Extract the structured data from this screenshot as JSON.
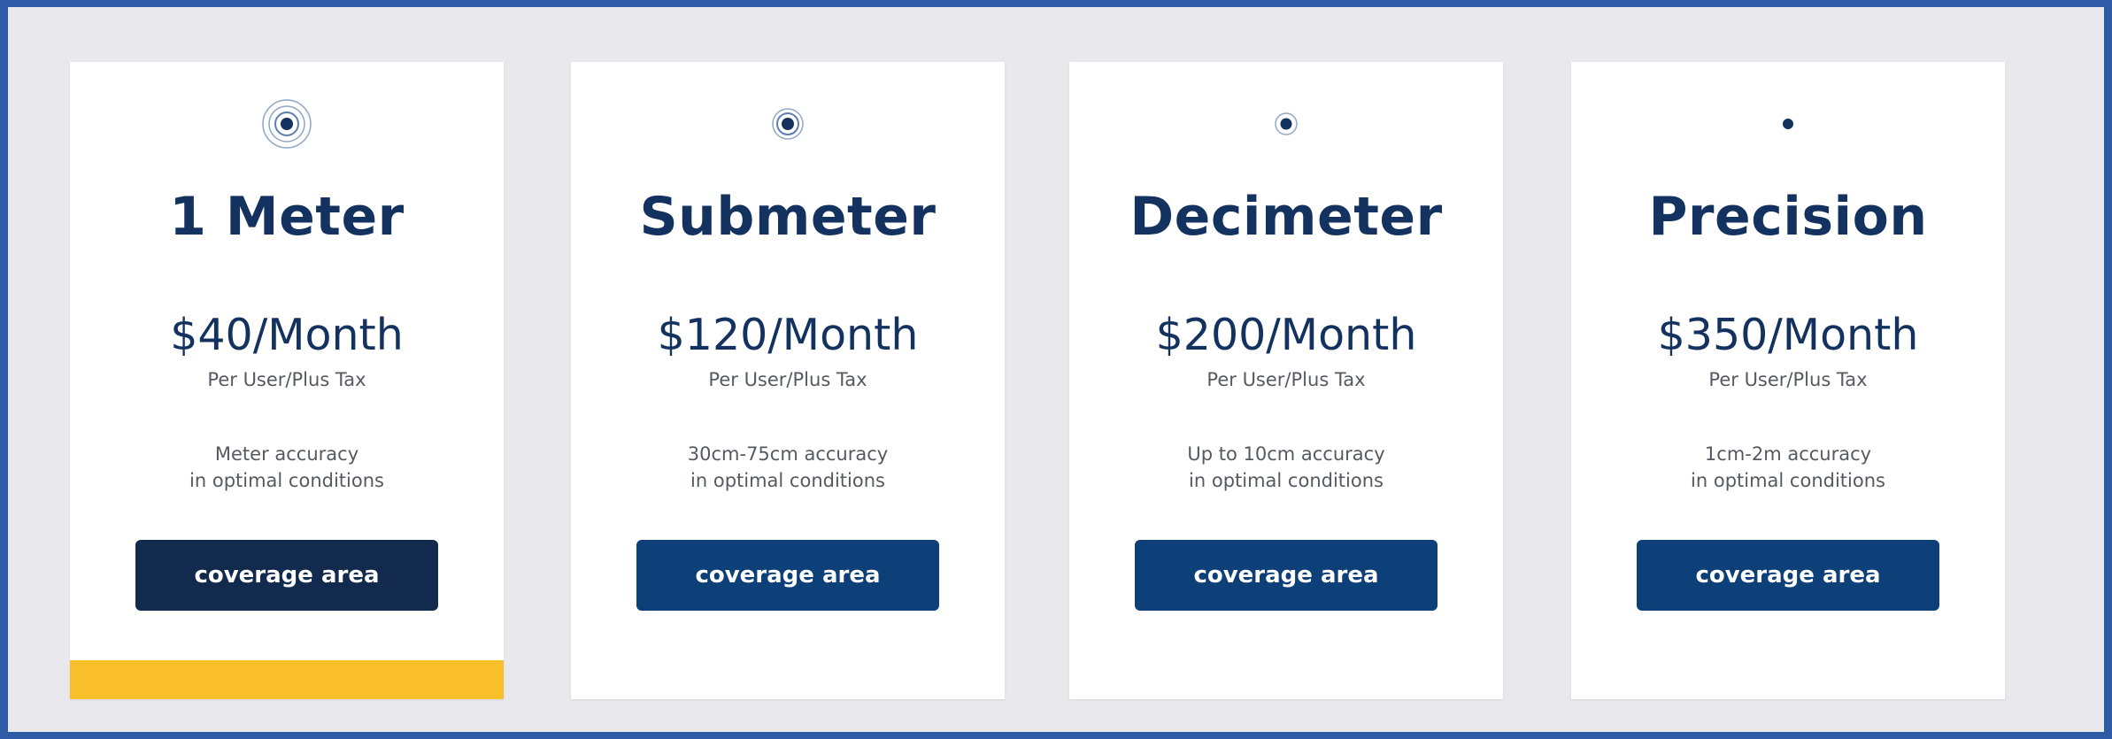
{
  "colors": {
    "frame_border": "#2e5aa6",
    "background": "#e9e9ed",
    "card": "#ffffff",
    "title_text": "#13325f",
    "body_text": "#555a62",
    "button": "#0d3f78",
    "button_selected": "#122a4e",
    "selected_bar": "#f8bf2b"
  },
  "plans": [
    {
      "icon": "signal-rings-large-icon",
      "title": "1 Meter",
      "price": "$40/Month",
      "per": "Per User/Plus Tax",
      "accuracy_line1": "Meter accuracy",
      "accuracy_line2": "in optimal conditions",
      "button_label": "coverage area",
      "selected": true
    },
    {
      "icon": "signal-rings-medium-icon",
      "title": "Submeter",
      "price": "$120/Month",
      "per": "Per User/Plus Tax",
      "accuracy_line1": "30cm-75cm accuracy",
      "accuracy_line2": "in optimal conditions",
      "button_label": "coverage area",
      "selected": false
    },
    {
      "icon": "signal-rings-small-icon",
      "title": "Decimeter",
      "price": "$200/Month",
      "per": "Per User/Plus Tax",
      "accuracy_line1": "Up to 10cm accuracy",
      "accuracy_line2": "in optimal conditions",
      "button_label": "coverage area",
      "selected": false
    },
    {
      "icon": "dot-icon",
      "title": "Precision",
      "price": "$350/Month",
      "per": "Per User/Plus Tax",
      "accuracy_line1": "1cm-2m accuracy",
      "accuracy_line2": "in optimal conditions",
      "button_label": "coverage area",
      "selected": false
    }
  ]
}
